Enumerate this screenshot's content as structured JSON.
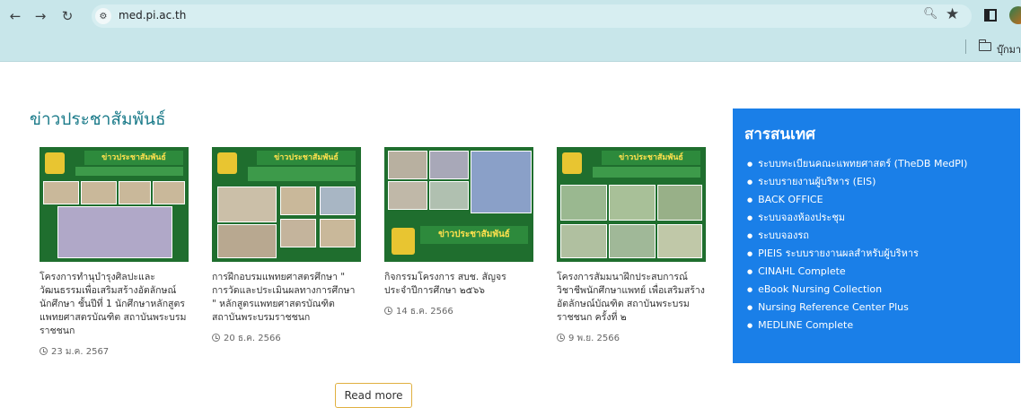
{
  "browser": {
    "url": "med.pi.ac.th",
    "bookmark_folder_label": "บุ๊กมา"
  },
  "news": {
    "section_title": "ข่าวประชาสัมพันธ์",
    "items": [
      {
        "image_banner": "ข่าวประชาสัมพันธ์",
        "title": "โครงการทำนุบำรุงศิลปะและวัฒนธรรมเพื่อเสริมสร้างอัตลักษณ์นักศึกษา ชั้นปีที่ 1 นักศึกษาหลักสูตรแพทยศาสตรบัณฑิต สถาบันพระบรมราชชนก",
        "date": "23 ม.ค. 2567"
      },
      {
        "image_banner": "ข่าวประชาสัมพันธ์",
        "title": "การฝึกอบรมแพทยศาสตรศึกษา \" การวัดและประเมินผลทางการศึกษา \" หลักสูตรแพทยศาสตรบัณฑิต สถาบันพระบรมราชชนก",
        "date": "20 ธ.ค. 2566"
      },
      {
        "image_banner": "ข่าวประชาสัมพันธ์",
        "title": "กิจกรรมโครงการ สบช. สัญจร ประจำปีการศึกษา ๒๕๖๖",
        "date": "14 ธ.ค. 2566"
      },
      {
        "image_banner": "ข่าวประชาสัมพันธ์",
        "title": "โครงการสัมมนาฝึกประสบการณ์วิชาชีพนักศึกษาแพทย์ เพื่อเสริมสร้างอัตลักษณ์บัณฑิต สถาบันพระบรมราชชนก ครั้งที่ ๒",
        "date": "9 พ.ย. 2566"
      }
    ],
    "read_more_label": "Read more"
  },
  "info": {
    "title": "สารสนเทศ",
    "links": [
      "ระบบทะเบียนคณะแพทยศาสตร์ (TheDB MedPI)",
      "ระบบรายงานผู้บริหาร (EIS)",
      "BACK OFFICE",
      "ระบบจองห้องประชุม",
      "ระบบจองรถ",
      "PIEIS ระบบรายงานผลสำหรับผู้บริหาร",
      "CINAHL Complete",
      "eBook Nursing Collection",
      "Nursing Reference Center Plus",
      "MEDLINE Complete"
    ]
  },
  "colors": {
    "chrome_bg": "#c8e6ea",
    "title_teal": "#1a7a89",
    "info_panel_blue": "#1a7fe8",
    "read_more_border": "#e0b040"
  }
}
